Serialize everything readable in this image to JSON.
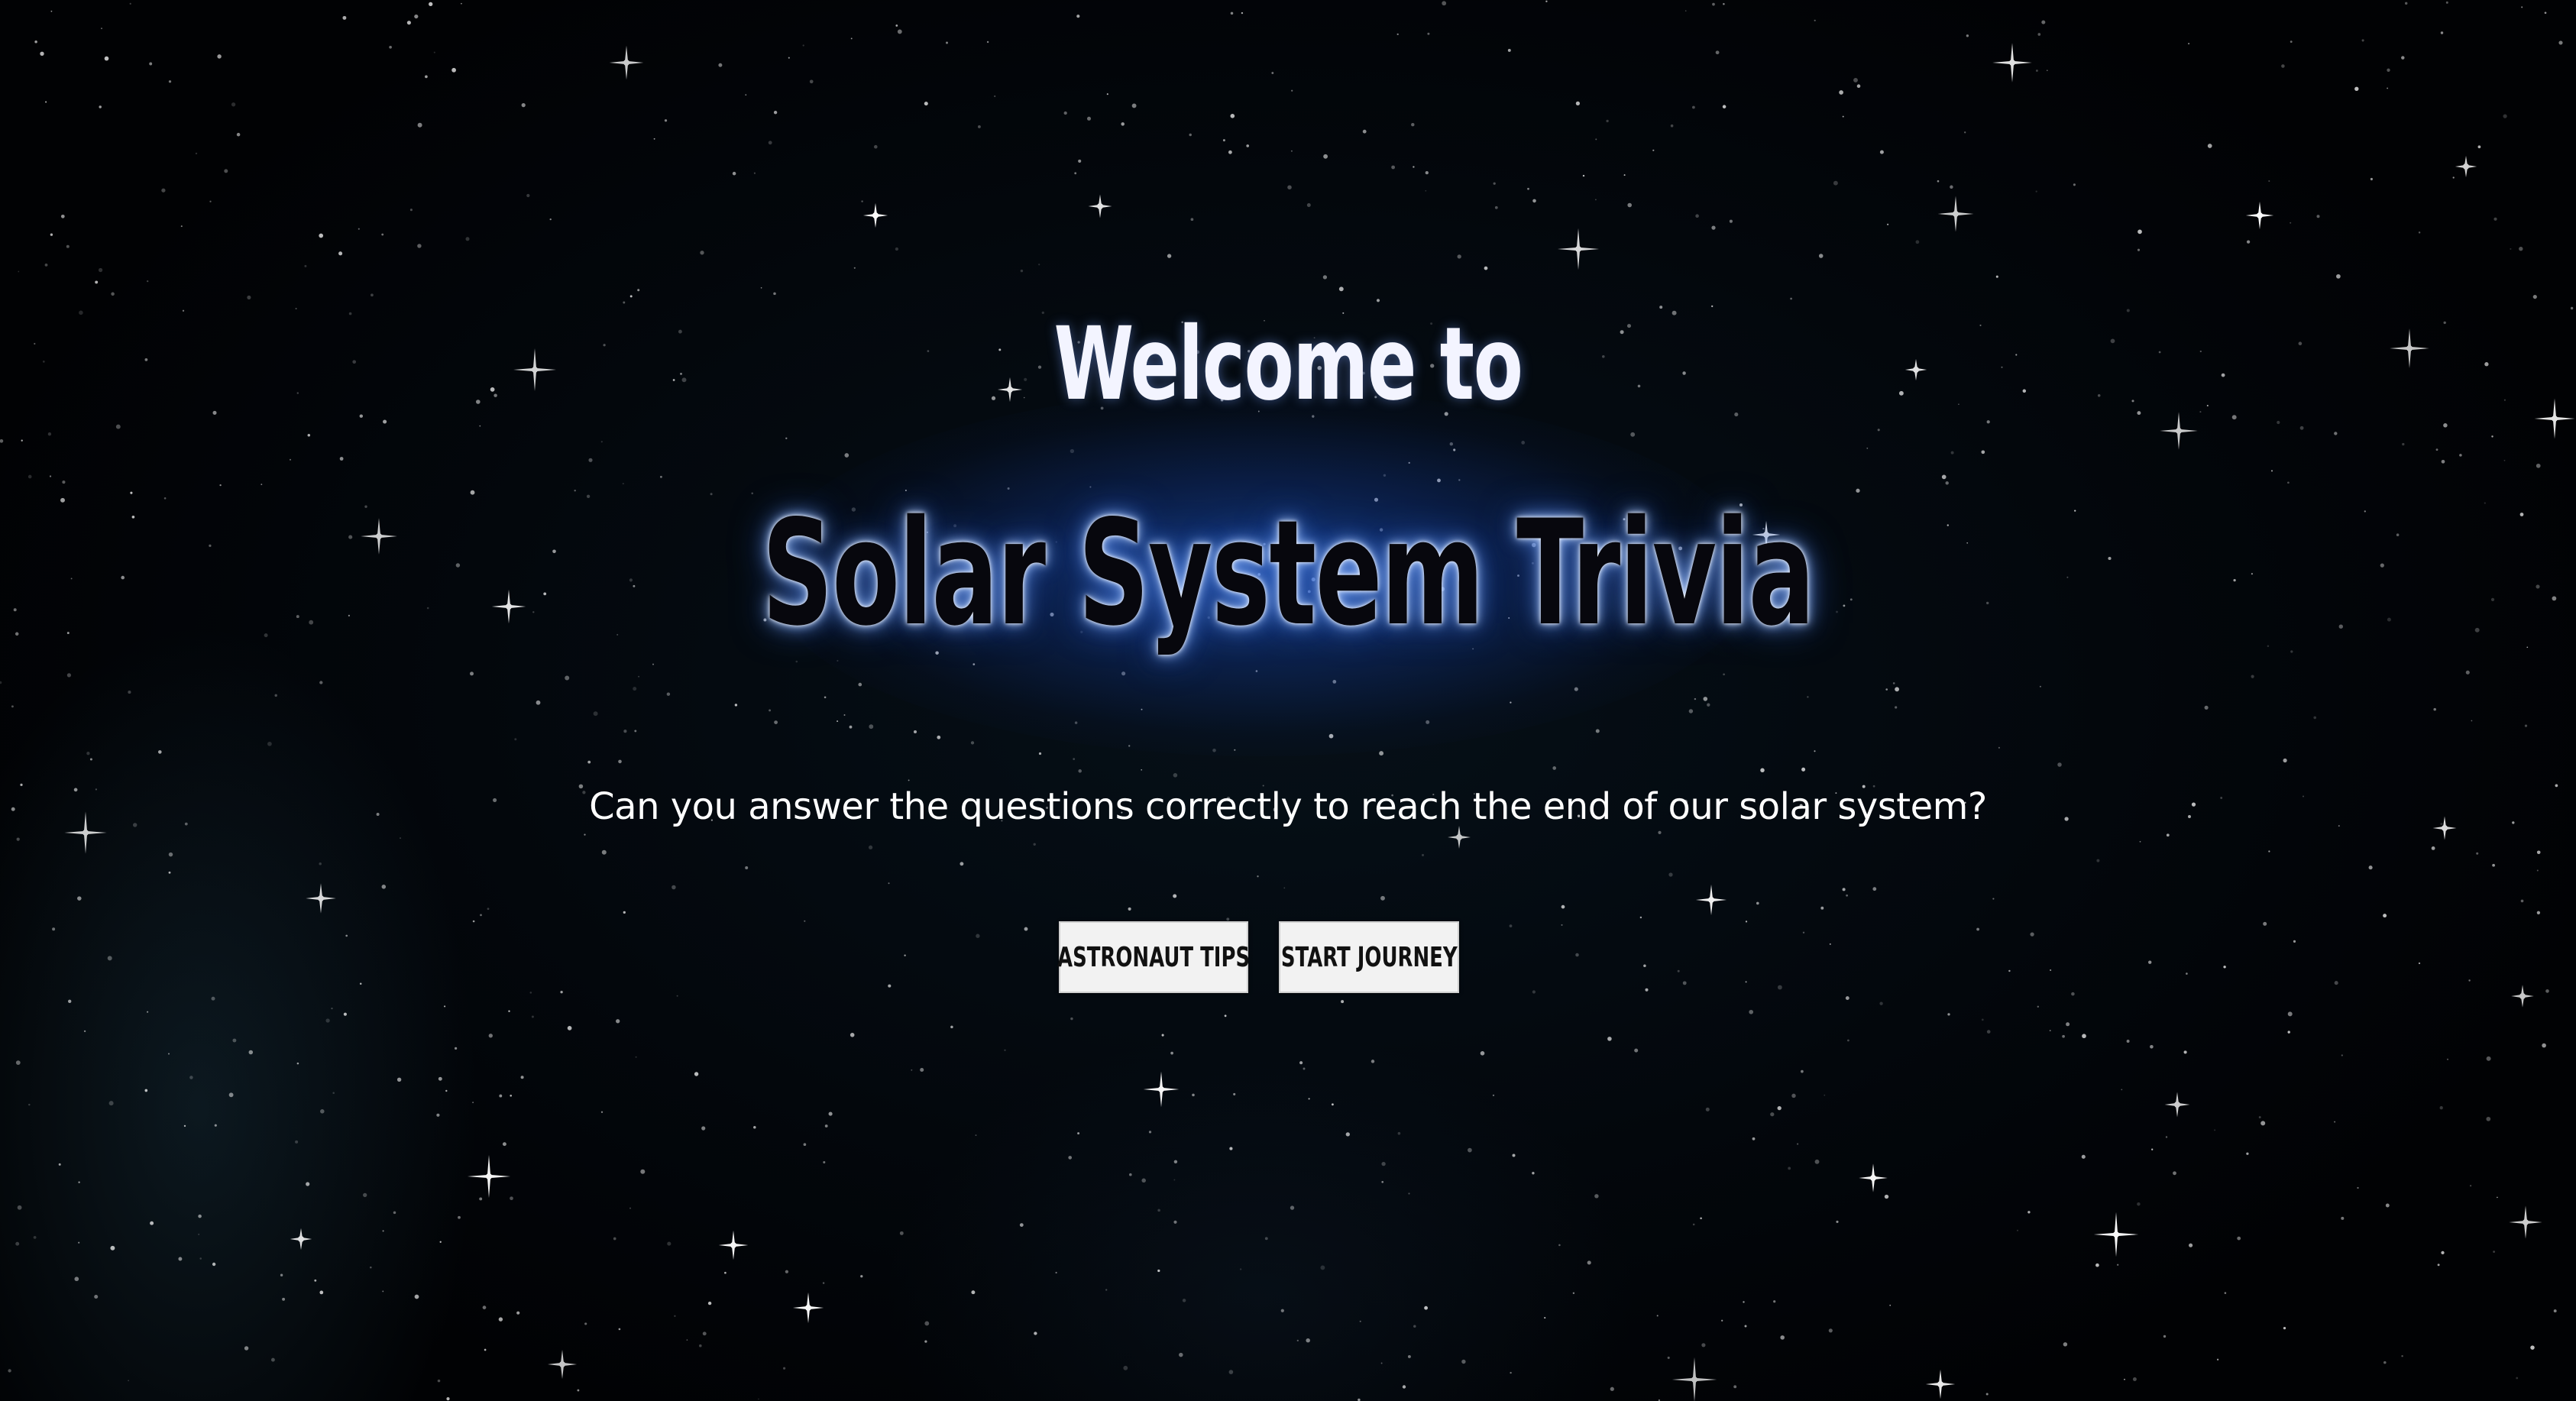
{
  "welcome": {
    "heading": "Welcome to",
    "title": "Solar System Trivia",
    "subtitle": "Can you answer the questions correctly to reach the end of our solar system?"
  },
  "buttons": {
    "tips_label": "ASTRONAUT TIPS",
    "start_label": "START JOURNEY"
  },
  "colors": {
    "background": "#020408",
    "title_glow": "#1e5ad2",
    "button_bg": "#f2f2f2",
    "text": "#ffffff"
  }
}
